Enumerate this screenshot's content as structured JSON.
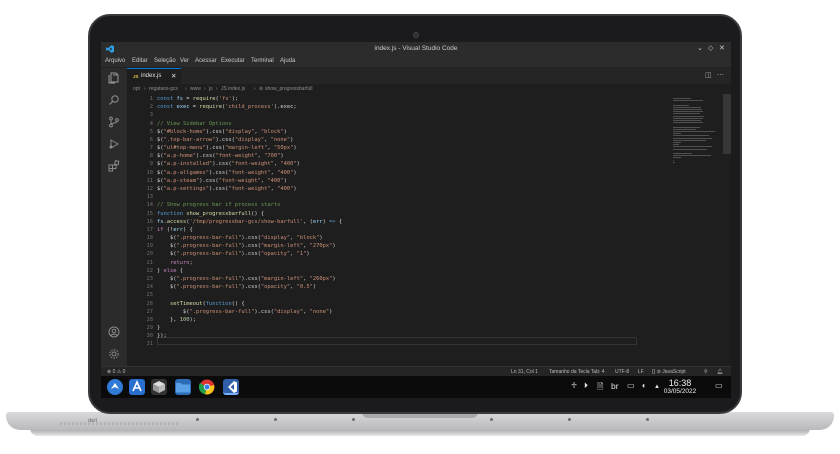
{
  "window": {
    "title": "index.js - Visual Studio Code",
    "minimize_glyph": "⌄",
    "maximize_glyph": "◇",
    "close_glyph": "✕"
  },
  "menu": [
    "Arquivo",
    "Editar",
    "Seleção",
    "Ver",
    "Acessar",
    "Executar",
    "Terminal",
    "Ajuda"
  ],
  "tab": {
    "badge": "JS",
    "name": "index.js",
    "close": "✕"
  },
  "breadcrumb": [
    "opt",
    "regataos-gcs",
    "www",
    "js",
    "JS index.js",
    "show_progressbarfull"
  ],
  "code": [
    {
      "n": "1",
      "html": "<span class='c-kw'>const</span> <span class='c-var'>fs</span> = <span class='c-fn'>require</span>(<span class='c-str'>'fs'</span>);"
    },
    {
      "n": "2",
      "html": "<span class='c-kw'>const</span> <span class='c-var'>exec</span> = <span class='c-fn'>require</span>(<span class='c-str'>'child_process'</span>).exec;"
    },
    {
      "n": "3",
      "html": ""
    },
    {
      "n": "4",
      "html": "<span class='c-com'>// View Sidebar Options</span>"
    },
    {
      "n": "5",
      "html": "$(<span class='c-str'>\"#block-home\"</span>).css(<span class='c-str'>\"display\"</span>, <span class='c-str'>\"block\"</span>)"
    },
    {
      "n": "6",
      "html": "$(<span class='c-str'>\".top-bar-arrow\"</span>).css(<span class='c-str'>\"display\"</span>, <span class='c-str'>\"none\"</span>)"
    },
    {
      "n": "7",
      "html": "$(<span class='c-str'>\"ul#top-menu\"</span>).css(<span class='c-str'>\"margin-left\"</span>, <span class='c-str'>\"50px\"</span>)"
    },
    {
      "n": "8",
      "html": "$(<span class='c-str'>\"a.p-home\"</span>).css(<span class='c-str'>\"font-weight\"</span>, <span class='c-str'>\"700\"</span>)"
    },
    {
      "n": "9",
      "html": "$(<span class='c-str'>\"a.p-installed\"</span>).css(<span class='c-str'>\"font-weight\"</span>, <span class='c-str'>\"400\"</span>)"
    },
    {
      "n": "10",
      "html": "$(<span class='c-str'>\"a.p-allgames\"</span>).css(<span class='c-str'>\"font-weight\"</span>, <span class='c-str'>\"400\"</span>)"
    },
    {
      "n": "11",
      "html": "$(<span class='c-str'>\"a.p-steam\"</span>).css(<span class='c-str'>\"font-weight\"</span>, <span class='c-str'>\"400\"</span>)"
    },
    {
      "n": "12",
      "html": "$(<span class='c-str'>\"a.p-settings\"</span>).css(<span class='c-str'>\"font-weight\"</span>, <span class='c-str'>\"400\"</span>)"
    },
    {
      "n": "13",
      "html": ""
    },
    {
      "n": "14",
      "html": "<span class='c-com'>// Show progress bar if process starts</span>"
    },
    {
      "n": "15",
      "html": "<span class='c-kw'>function</span> <span class='c-fn'>show_progressbarfull</span>() {"
    },
    {
      "n": "16",
      "html": "<span class='c-var'>fs</span>.<span class='c-fn'>access</span>(<span class='c-str'>'/tmp/progressbar-gcs/show-barfull'</span>, (<span class='c-var'>err</span>) <span class='c-kw'>=&gt;</span> {"
    },
    {
      "n": "17",
      "html": "<span class='c-ctl'>if</span> (!<span class='c-var'>err</span>) {"
    },
    {
      "n": "18",
      "html": "    $(<span class='c-str'>\".progress-bar-full\"</span>).css(<span class='c-str'>\"display\"</span>, <span class='c-str'>\"block\"</span>)"
    },
    {
      "n": "19",
      "html": "    $(<span class='c-str'>\".progress-bar-full\"</span>).css(<span class='c-str'>\"margin-left\"</span>, <span class='c-str'>\"270px\"</span>)"
    },
    {
      "n": "20",
      "html": "    $(<span class='c-str'>\".progress-bar-full\"</span>).css(<span class='c-str'>\"opacity\"</span>, <span class='c-str'>\"1\"</span>)"
    },
    {
      "n": "21",
      "html": "    <span class='c-ctl'>return</span>;"
    },
    {
      "n": "22",
      "html": "} <span class='c-ctl'>else</span> {"
    },
    {
      "n": "23",
      "html": "    $(<span class='c-str'>\".progress-bar-full\"</span>).css(<span class='c-str'>\"margin-left\"</span>, <span class='c-str'>\"260px\"</span>)"
    },
    {
      "n": "24",
      "html": "    $(<span class='c-str'>\".progress-bar-full\"</span>).css(<span class='c-str'>\"opacity\"</span>, <span class='c-str'>\"0.5\"</span>)"
    },
    {
      "n": "25",
      "html": ""
    },
    {
      "n": "26",
      "html": "    <span class='c-fn'>setTimeout</span>(<span class='c-kw'>function</span>() {"
    },
    {
      "n": "27",
      "html": "        $(<span class='c-str'>\".progress-bar-full\"</span>).css(<span class='c-str'>\"display\"</span>, <span class='c-str'>\"none\"</span>)"
    },
    {
      "n": "28",
      "html": "    }, <span class='c-num'>100</span>);"
    },
    {
      "n": "29",
      "html": "}"
    },
    {
      "n": "30",
      "html": "});"
    },
    {
      "n": "31",
      "html": ""
    }
  ],
  "status": {
    "problems": "⊗ 0 ⚠ 0",
    "position": "Ln 31, Col 1",
    "tab_size": "Tamanho da Tecla Tab: 4",
    "encoding": "UTF-8",
    "eol": "LF",
    "language": "{} ⊘ JavaScript"
  },
  "taskbar": {
    "time": "16:38",
    "date": "03/05/2022",
    "keyboard": "br"
  },
  "laptop_brand": "dell"
}
